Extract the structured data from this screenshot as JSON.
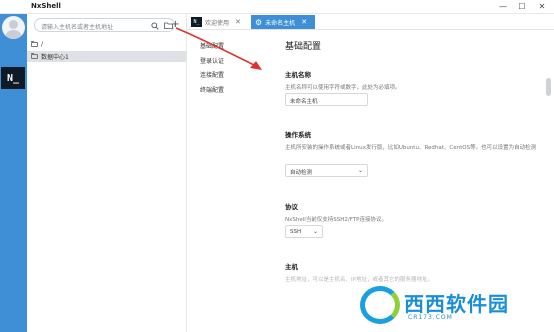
{
  "window": {
    "title": "NxShell",
    "min_glyph": "—",
    "max_glyph": "☐",
    "close_glyph": "✕"
  },
  "rail": {
    "logo_text": "N_"
  },
  "sidebar": {
    "search_placeholder": "请输入主机名或者主机地址",
    "search_icon": "search-icon",
    "folder_open_icon": "folder-icon",
    "add_label": "+",
    "tree": [
      {
        "label": "/",
        "selected": false
      },
      {
        "label": "数据中心1",
        "selected": true
      }
    ]
  },
  "tabs": [
    {
      "label": "欢迎使用",
      "badge": "N_",
      "active": false
    },
    {
      "label": "未命名主机",
      "icon": "gear-icon",
      "active": true
    }
  ],
  "subnav": [
    "基础配置",
    "登录认证",
    "连接配置",
    "终端配置"
  ],
  "main": {
    "heading": "基础配置",
    "sections": [
      {
        "title": "主机名称",
        "desc": "主机名称可以使用字符或数字，此处为必填项。",
        "control": "input",
        "value": "未命名主机"
      },
      {
        "title": "操作系统",
        "desc": "主机所安装的操作系统或者Linux发行版，比如Ubuntu、Redhat、CentOS等。也可以设置为自动检测",
        "control": "select",
        "value": "自动检测"
      },
      {
        "title": "协议",
        "desc": "NxShell当前仅支持SSH2/FTP连接协议。",
        "control": "select",
        "value": "SSH"
      },
      {
        "title": "主机",
        "desc": "主机地址，可以是主机名、IP地址，或者其它的服务器地址。",
        "control": "none",
        "value": ""
      }
    ]
  },
  "watermark": {
    "text": "西西软件园",
    "sub": "CR173.COM"
  },
  "colors": {
    "accent": "#3f8fd6",
    "logo_bg": "#0e1a26",
    "arrow": "#e0322d"
  }
}
